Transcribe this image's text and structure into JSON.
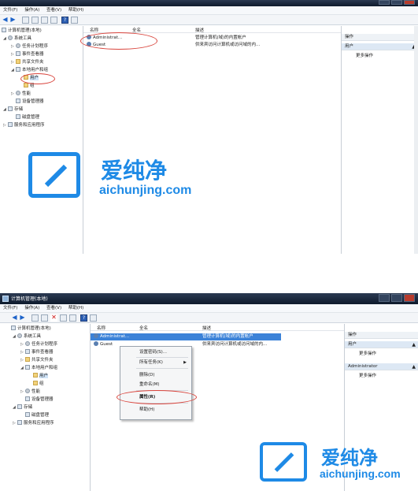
{
  "window": {
    "title": "计算机管理(本地)"
  },
  "menu": [
    "文件(F)",
    "操作(A)",
    "查看(V)",
    "帮助(H)"
  ],
  "tree": {
    "root": "计算机管理(本地)",
    "system_tools": "系统工具",
    "task_scheduler": "任务计划程序",
    "event_viewer": "事件查看器",
    "shared_folders": "共享文件夹",
    "local_users_groups": "本地用户和组",
    "users": "用户",
    "groups": "组",
    "performance": "性能",
    "device_manager": "设备管理器",
    "storage": "存储",
    "disk_management": "磁盘管理",
    "services_apps": "服务和应用程序"
  },
  "list": {
    "columns": [
      "名称",
      "全名",
      "描述"
    ],
    "rows": [
      {
        "name": "Administrat...",
        "name_full": "Administrator",
        "fullname": "",
        "desc": "管理计算机(域)的内置帐户",
        "desc_short": "管理计算机(域)的内置帐户"
      },
      {
        "name": "Guest",
        "fullname": "",
        "desc": "供来宾访问计算机或访问域的内...",
        "desc_short": "供来宾访问计算机或访问域的内..."
      }
    ]
  },
  "actions": {
    "header": "操作",
    "section_users": "用户",
    "more": "更多操作",
    "section_admin": "Administrator"
  },
  "context_menu": {
    "set_password": "设置密码(S)...",
    "all_tasks": "所有任务(K)",
    "delete": "删除(D)",
    "rename": "重命名(M)",
    "properties": "属性(R)",
    "help": "帮助(H)"
  },
  "watermark": {
    "cn": "爱纯净",
    "en": "aichunjing.com"
  },
  "colors": {
    "accent": "#1e8ae6",
    "highlight": "#3b82d8",
    "circle": "#d9443c"
  }
}
